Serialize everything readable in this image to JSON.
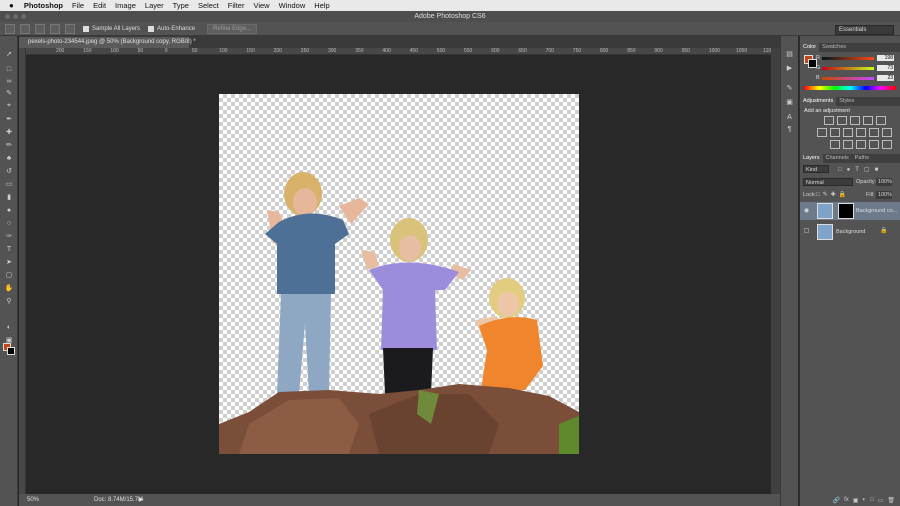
{
  "menubar": {
    "apple": "",
    "app": "Photoshop",
    "items": [
      "File",
      "Edit",
      "Image",
      "Layer",
      "Type",
      "Select",
      "Filter",
      "View",
      "Window",
      "Help"
    ]
  },
  "titlebar": {
    "title": "Adobe Photoshop CS6"
  },
  "options": {
    "sample_all": "Sample All Layers",
    "auto_enhance": "Auto-Enhance",
    "refine_edge": "Refine Edge...",
    "workspace": "Essentials"
  },
  "document": {
    "tab_title": "pexels-photo-234544.jpeg @ 50% (Background copy, RGB/8) *",
    "zoom": "50%",
    "doc_size": "Doc: 8.74M/15.7M"
  },
  "ruler": {
    "ticks": [
      "200",
      "150",
      "100",
      "50",
      "0",
      "50",
      "100",
      "150",
      "200",
      "250",
      "300",
      "350",
      "400",
      "450",
      "500",
      "550",
      "600",
      "650",
      "700",
      "750",
      "800",
      "850",
      "900",
      "950",
      "1000",
      "1050",
      "1100"
    ]
  },
  "color_panel": {
    "tabs": [
      "Color",
      "Swatches"
    ],
    "r": "198",
    "g": "73",
    "b": "23",
    "fg": "#c1461a",
    "bg": "#000000"
  },
  "adjust_panel": {
    "tabs": [
      "Adjustments",
      "Styles"
    ],
    "heading": "Add an adjustment"
  },
  "layers_panel": {
    "tabs": [
      "Layers",
      "Channels",
      "Paths"
    ],
    "kind": "Kind",
    "blend": "Normal",
    "opacity_label": "Opacity:",
    "opacity": "100%",
    "lock_label": "Lock:",
    "fill_label": "Fill:",
    "fill": "100%",
    "layers": [
      {
        "name": "Background co...",
        "selected": true
      },
      {
        "name": "Background",
        "selected": false
      }
    ]
  }
}
